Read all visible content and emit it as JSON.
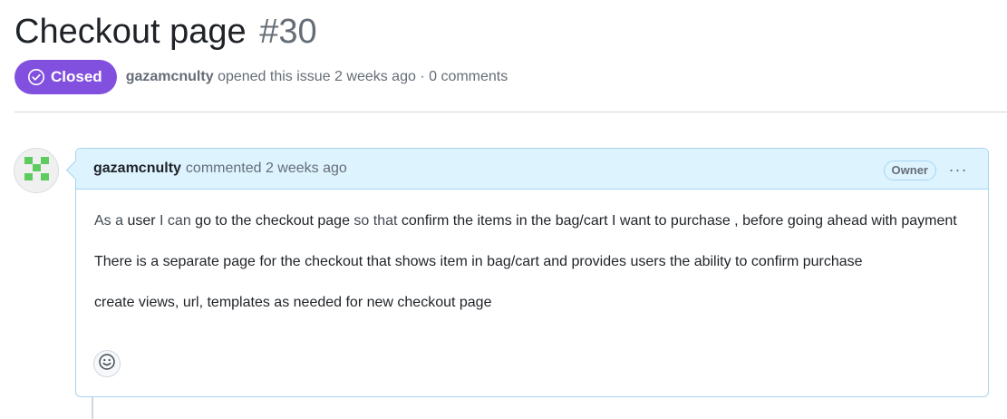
{
  "issue": {
    "title": "Checkout page",
    "number": "#30",
    "state": "Closed",
    "author": "gazamcnulty",
    "opened_text": "opened this issue 2 weeks ago · 0 comments"
  },
  "comment": {
    "author": "gazamcnulty",
    "action_text": "commented 2 weeks ago",
    "role_label": "Owner",
    "more_label": "···",
    "body": {
      "p1": {
        "t1": "As a ",
        "t2": "user",
        "t3": " I can ",
        "t4": "go to the checkout page",
        "t5": " so that ",
        "t6": "confirm the items in the bag/cart I want to purchase , before going ahead with payment"
      },
      "p2": "There is a separate page for the checkout that shows item in bag/cart and provides users the ability to confirm purchase",
      "p3": "create views, url, templates as needed for new checkout page"
    }
  },
  "colors": {
    "closed_badge": "#8250df",
    "comment_header_bg": "#ddf4ff",
    "comment_border": "#a9d3f0",
    "avatar_pixels": "#5ecb61"
  },
  "icons": {
    "state": "check-circle-icon",
    "more": "kebab-horizontal-icon",
    "reaction": "smiley-icon",
    "avatar": "identicon"
  }
}
